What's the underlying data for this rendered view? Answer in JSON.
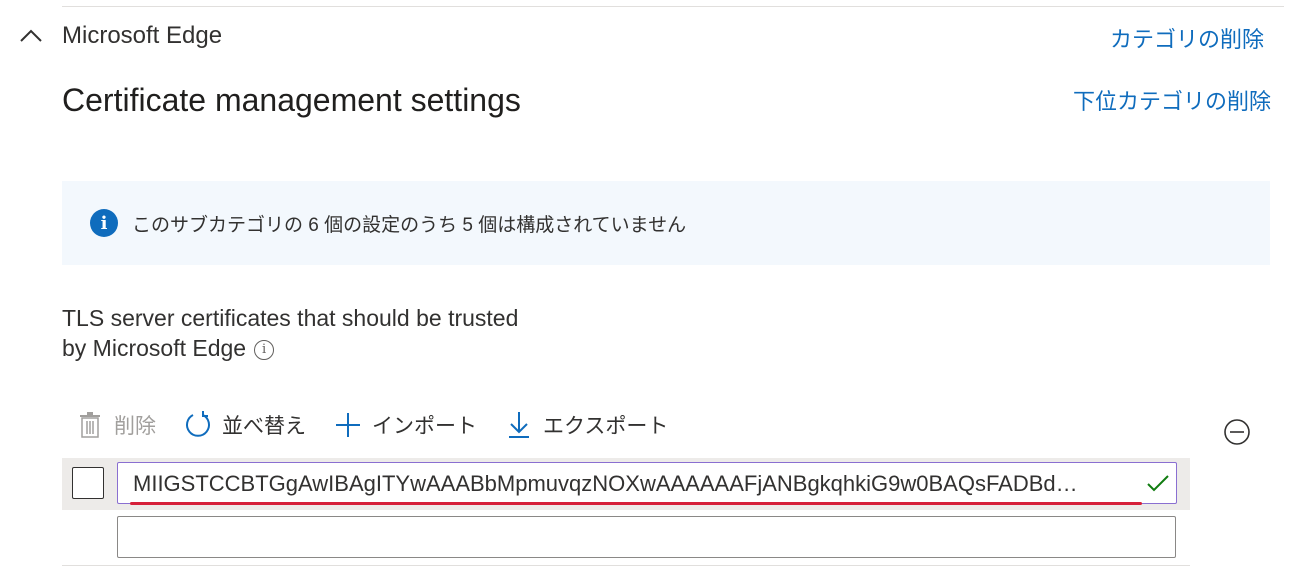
{
  "section": {
    "title": "Microsoft Edge",
    "remove_category_label": "カテゴリの削除"
  },
  "subcategory": {
    "title": "Certificate management settings",
    "remove_subcategory_label": "下位カテゴリの削除"
  },
  "info_banner": {
    "text": "このサブカテゴリの 6 個の設定のうち 5 個は構成されていません"
  },
  "setting": {
    "label": "TLS server certificates that should be trusted by Microsoft Edge",
    "help_icon": "info-circle-icon"
  },
  "toolbar": {
    "delete_label": "削除",
    "reorder_label": "並べ替え",
    "import_label": "インポート",
    "export_label": "エクスポート"
  },
  "list": {
    "rows": [
      {
        "value": "MIIGSTCCBTGgAwIBAgITYwAAABbMpmuvqzNOXwAAAAAAFjANBgkqhkiG9w0BAQsFADBd…",
        "valid": true
      },
      {
        "value": "",
        "valid": false
      }
    ]
  },
  "colors": {
    "link": "#0f6cbd",
    "info_background": "#f3f8fd",
    "row_selected_background": "#edebe9",
    "valid_check": "#107c10",
    "spell_underline": "#d6203a"
  }
}
